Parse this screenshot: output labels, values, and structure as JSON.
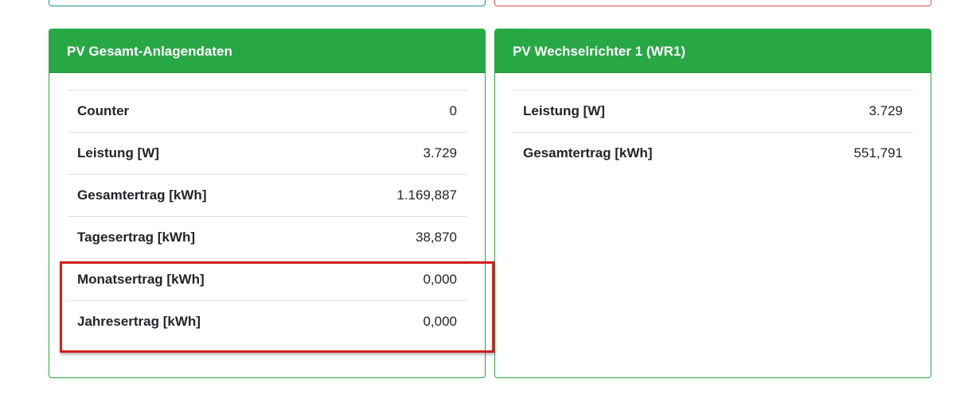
{
  "left_card": {
    "title": "PV Gesamt-Anlagendaten",
    "rows": [
      {
        "label": "Counter",
        "value": "0"
      },
      {
        "label": "Leistung [W]",
        "value": "3.729"
      },
      {
        "label": "Gesamtertrag [kWh]",
        "value": "1.169,887"
      },
      {
        "label": "Tagesertrag [kWh]",
        "value": "38,870"
      },
      {
        "label": "Monatsertrag [kWh]",
        "value": "0,000"
      },
      {
        "label": "Jahresertrag [kWh]",
        "value": "0,000"
      }
    ]
  },
  "right_card": {
    "title": "PV Wechselrichter 1 (WR1)",
    "rows": [
      {
        "label": "Leistung [W]",
        "value": "3.729"
      },
      {
        "label": "Gesamtertrag [kWh]",
        "value": "551,791"
      }
    ]
  },
  "colors": {
    "header_green": "#28a745",
    "highlight_red": "#d21f1f"
  }
}
